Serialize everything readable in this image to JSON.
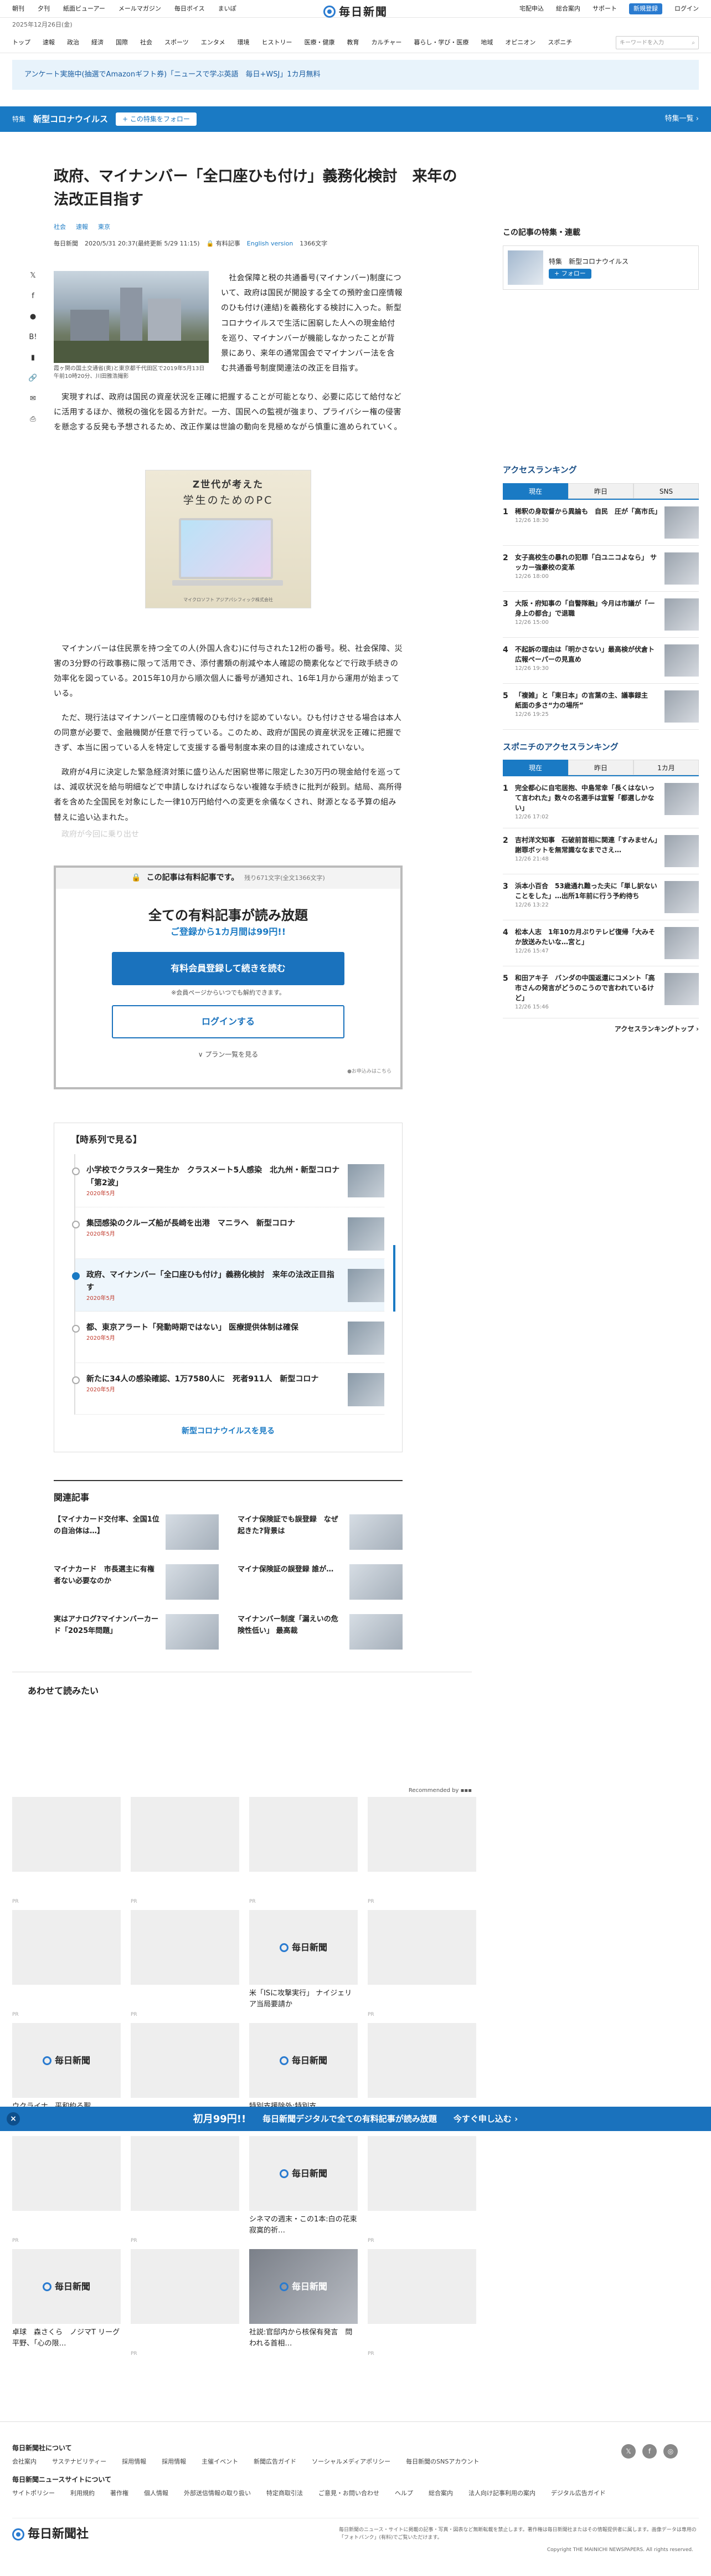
{
  "header": {
    "util_left": [
      "朝刊",
      "夕刊",
      "紙面ビューアー",
      "メールマガジン",
      "毎日ボイス",
      "まいぽ"
    ],
    "logo": "毎日新聞",
    "util_right": [
      "宅配申込",
      "総合案内",
      "サポート"
    ],
    "register": "新規登録",
    "login": "ログイン",
    "date": "2025年12月26日(金)",
    "nav": [
      "トップ",
      "速報",
      "政治",
      "経済",
      "国際",
      "社会",
      "スポーツ",
      "エンタメ",
      "環境",
      "ヒストリー",
      "医療・健康",
      "教育",
      "カルチャー",
      "暮らし・学び・医療",
      "地域",
      "オピニオン",
      "スポニチ"
    ],
    "search_placeholder": "キーワードを入力"
  },
  "notice": "アンケート実施中(抽選でAmazonギフト券)「ニュースで学ぶ英語　毎日+WSJ」1カ月無料",
  "feature_bar": {
    "tag": "特集",
    "title": "新型コロナウイルス",
    "follow": "+ この特集をフォロー",
    "list": "特集一覧 ›"
  },
  "article": {
    "title": "政府、マイナンバー「全口座ひも付け」義務化検討　来年の法改正目指す",
    "categories": [
      "社会",
      "速報",
      "東京"
    ],
    "meta": {
      "source": "毎日新聞",
      "dates": "2020/5/31 20:37(最終更新 5/29 11:15)",
      "paid": "有料記事",
      "english": "English version",
      "chars": "1366文字"
    },
    "share": [
      "X",
      "facebook",
      "line",
      "hatena",
      "bookmark",
      "link",
      "mail",
      "print"
    ],
    "photo_caption": "霞ヶ関の国土交通省(奥)と東京都千代田区で2019年5月13日午前10時20分、川田雅浩撮影",
    "lead": "　社会保障と税の共通番号(マイナンバー)制度について、政府は国民が開設する全ての預貯金口座情報のひも付け(連結)を義務化する検討に入った。新型コロナウイルスで生活に困窮した人への現金給付を巡り、マイナンバーが機能しなかったことが背景にあり、来年の通常国会でマイナンバー法を含む共通番号制度関連法の改正を目指す。",
    "paragraphs": [
      "実現すれば、政府は国民の資産状況を正確に把握することが可能となり、必要に応じて給付などに活用するほか、徴税の強化を図る方針だ。一方、国民への監視が強まり、プライバシー権の侵害を懸念する反発も予想されるため、改正作業は世論の動向を見極めながら慎重に進められていく。",
      "マイナンバーは住民票を持つ全ての人(外国人含む)に付与された12桁の番号。税、社会保障、災害の3分野の行政事務に限って活用でき、添付書類の削減や本人確認の簡素化などで行政手続きの効率化を図っている。2015年10月から順次個人に番号が通知され、16年1月から運用が始まっている。",
      "ただ、現行法はマイナンバーと口座情報のひも付けを認めていない。ひも付けさせる場合は本人の同意が必要で、金融機関が任意で行っている。このため、政府が国民の資産状況を正確に把握できず、本当に困っている人を特定して支援する番号制度本来の目的は達成されていない。",
      "政府が4月に決定した緊急経済対策に盛り込んだ困窮世帯に限定した30万円の現金給付を巡っては、減収状況を給与明細などで申請しなければならない複雑な手続きに批判が殺到。結局、高所得者を含めた全国民を対象にした一律10万円給付への変更を余儀なくされ、財源となる予算の組み替えに追い込まれた。"
    ],
    "fade": "政府が今回に乗り出せ"
  },
  "ad": {
    "line1": "Z世代が考えた",
    "line2": "学生のためのPC",
    "footer": "マイクロソフト アジアパシフィック株式会社"
  },
  "paywall": {
    "head": "この記事は有料記事です。",
    "remain": "残り671文字(全文1366文字)",
    "title": "全ての有料記事が読み放題",
    "sub": "ご登録から1カ月間は99円!!",
    "register": "有料会員登録して続きを読む",
    "note": "※会員ページからいつでも解約できます。",
    "login": "ログインする",
    "plans": "∨ プラン一覧を見る",
    "foot": "●お申込みはこちら"
  },
  "timeline": {
    "head": "【時系列で見る】",
    "items": [
      {
        "title": "小学校でクラスター発生か　クラスメート5人感染　北九州・新型コロナ「第2波」",
        "date": "2020年5月"
      },
      {
        "title": "集団感染のクルーズ船が長崎を出港　マニラへ　新型コロナ",
        "date": "2020年5月"
      },
      {
        "title": "政府、マイナンバー「全口座ひも付け」義務化検討　来年の法改正目指す",
        "date": "2020年5月"
      },
      {
        "title": "都、東京アラート「発動時期ではない」 医療提供体制は確保",
        "date": "2020年5月"
      },
      {
        "title": "新たに34人の感染確認、1万7580人に　死者911人　新型コロナ",
        "date": "2020年5月"
      }
    ],
    "more": "新型コロナウイルスを見る"
  },
  "related": {
    "head": "関連記事",
    "items": [
      "【マイナカード交付率、全国1位の自治体は…】",
      "マイナ保険証でも誤登録　なぜ起きた?背景は",
      "マイナカード　市長選主に有権者ない必要なのか",
      "マイナ保険証の誤登録 誰が…",
      "実はアナログ?マイナンバーカード「2025年問題」",
      "マイナンバー制度「漏えいの危険性低い」 最高裁"
    ]
  },
  "recommend": {
    "head": "あわせて読みたい",
    "by": "Recommended by",
    "cards": [
      {
        "caption": "",
        "pr": "PR"
      },
      {
        "caption": "",
        "pr": "PR"
      },
      {
        "caption": "",
        "pr": "PR"
      },
      {
        "caption": "",
        "pr": "PR"
      },
      {
        "caption": "",
        "pr": "PR"
      },
      {
        "caption": "",
        "pr": "PR"
      },
      {
        "caption": "米「ISに攻撃実行」 ナイジェリア当局要請か",
        "pr": ""
      },
      {
        "caption": "",
        "pr": "PR"
      },
      {
        "caption": "ウクライナ、平和約る聖",
        "pr": ""
      },
      {
        "caption": "",
        "pr": "PR"
      },
      {
        "caption": "特別支援除外:特別支",
        "pr": ""
      },
      {
        "caption": "",
        "pr": "PR"
      },
      {
        "caption": "",
        "pr": "PR"
      },
      {
        "caption": "",
        "pr": "PR"
      },
      {
        "caption": "シネマの週末・この1本:白の花束　寂寞的祈…",
        "pr": ""
      },
      {
        "caption": "",
        "pr": "PR"
      },
      {
        "caption": "卓球　森さくら　ノジマT リーグ 平野、「心の限…",
        "pr": ""
      },
      {
        "caption": "",
        "pr": "PR"
      },
      {
        "caption": "社説:官邸内から核保有発言　問われる首相…",
        "pr": ""
      },
      {
        "caption": "",
        "pr": "PR"
      }
    ]
  },
  "sidebar": {
    "feature_title": "この記事の特集・連載",
    "feature": {
      "tag": "特集",
      "name": "新型コロナウイルス",
      "follow": "+ フォロー"
    },
    "ranking_title": "アクセスランキング",
    "tabs": [
      "現在",
      "昨日",
      "SNS"
    ],
    "ranking": [
      {
        "title": "稀釈の身取督から異論も　自民　圧が「高市氏」",
        "time": "12/26 18:30"
      },
      {
        "title": "女子高校生の暴れの犯罪「白ユニコよなら」 サッカー強豪校の変革",
        "time": "12/26 18:00"
      },
      {
        "title": "大阪・府知事の「自警隊融」今月は市議が「一身上の都合」で退職",
        "time": "12/26 15:00"
      },
      {
        "title": "不起訴の理由は「明かさない」最高検が伏倉ト広報ペーパーの見直め",
        "time": "12/26 19:30"
      },
      {
        "title": "「複雑」と「東日本」の言葉の主、議事録主　紙面の多さ“力の場所”",
        "time": "12/26 19:25"
      }
    ],
    "sponichi_title": "スポニチのアクセスランキング",
    "sponichi_tabs": [
      "現在",
      "昨日",
      "1カ月"
    ],
    "sponichi": [
      {
        "title": "完全都心に自宅居抱、中島常幸「長くはないって言われた」数々の名選手は宣誓「都選しかない」",
        "time": "12/26 17:02"
      },
      {
        "title": "吉村洋文知事　石破前首相に関連「すみません」謝罪ボットを無常識ななまでさえ…",
        "time": "12/26 21:48"
      },
      {
        "title": "浜本小百合　53歳通れ難った夫に「単し訳ないことをした」…出所1年前に行う予約待ち",
        "time": "12/26 13:22"
      },
      {
        "title": "松本人志　1年10カ月ぶりテレビ復帰「大みそか放送みたいな…宮と」",
        "time": "12/26 15:47"
      },
      {
        "title": "和田アキ子　バンダの中国返還にコメント「高市さんの発言がどうのこうので言われているけど」",
        "time": "12/26 15:46"
      }
    ],
    "ranking_more": "アクセスランキングトップ ›"
  },
  "sticky": {
    "offer": "初月99円!!",
    "text": "毎日新聞デジタルで全ての有料記事が読み放題",
    "cta": "今すぐ申し込む ›"
  },
  "footer": {
    "about": "毎日新聞社について",
    "row1": [
      "会社案内",
      "サステナビリティー",
      "採用情報",
      "採用情報",
      "主催イベント",
      "新聞広告ガイド",
      "ソーシャルメディアポリシー",
      "毎日新聞のSNSアカウント"
    ],
    "sites": "毎日新聞ニュースサイトについて",
    "row2": [
      "サイトポリシー",
      "利用規約",
      "著作権",
      "個人情報",
      "外部送信情報の取り扱い",
      "特定商取引法",
      "ご意見・お問い合わせ",
      "ヘルプ",
      "総合案内",
      "法人向け記事利用の案内",
      "デジタル広告ガイド"
    ],
    "logo": "毎日新聞社",
    "note": "毎日新聞のニュース・サイトに掲載の記事・写真・図表など無断転載を禁止します。著作権は毎日新聞社またはその情報提供者に属します。画像データは専用の「フォトバンク」(有料)でご覧いただけます。",
    "copy": "Copyright THE MAINICHI NEWSPAPERS. All rights reserved."
  }
}
